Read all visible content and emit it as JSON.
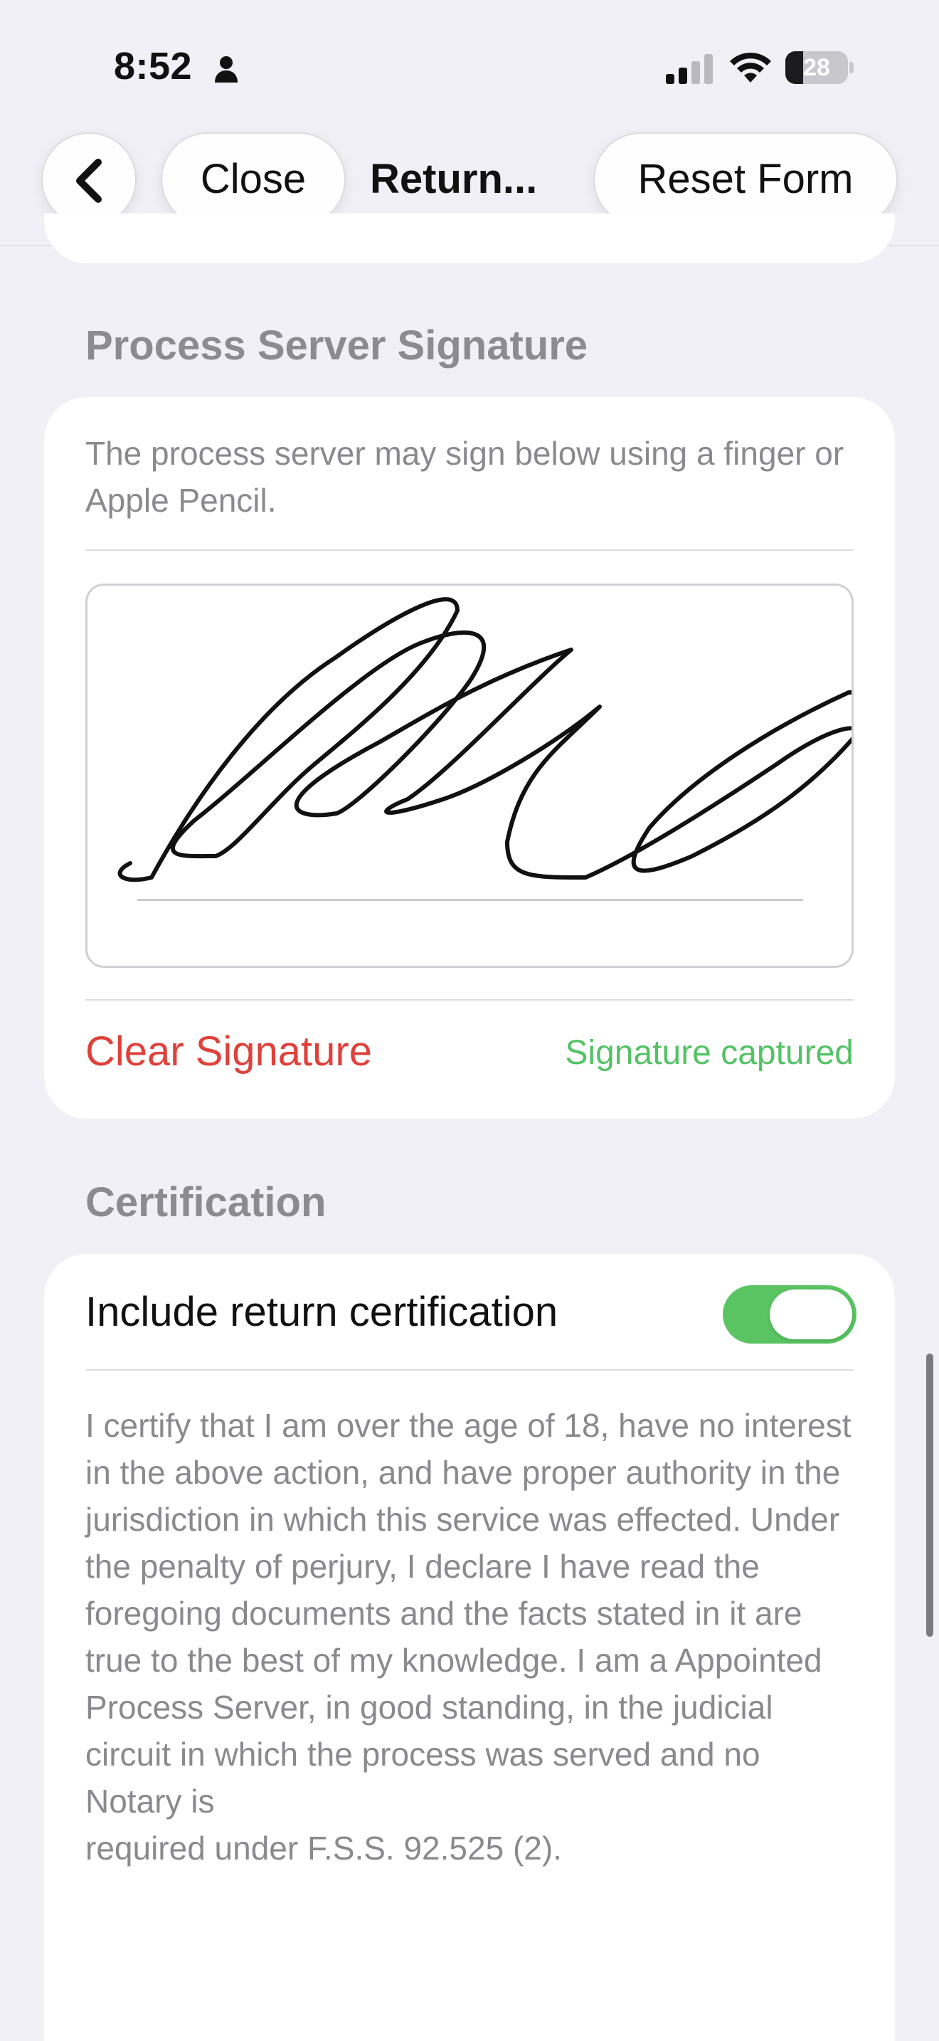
{
  "status_bar": {
    "time": "8:52",
    "battery_level": "28",
    "battery_fraction": 0.28,
    "icons": [
      "person-icon",
      "signal-icon",
      "wifi-icon",
      "battery-icon"
    ]
  },
  "nav": {
    "back_icon": "chevron-left-icon",
    "close_label": "Close",
    "title": "Return...",
    "reset_label": "Reset Form"
  },
  "signature_section": {
    "header": "Process Server Signature",
    "instructions": "The process server may sign below using a finger or Apple Pencil.",
    "clear_label": "Clear Signature",
    "status": "Signature captured"
  },
  "certification_section": {
    "header": "Certification",
    "toggle_label": "Include return certification",
    "toggle_on": true,
    "text_lines": [
      "I certify that I am over the age of 18, have no interest in the above action, and have proper authority in the",
      "jurisdiction in which this service was effected. Under the penalty of perjury, I declare I have read the",
      "foregoing documents and the facts stated in it are true to the best of my knowledge. I am a Appointed",
      "Process Server, in good standing, in the judicial circuit in which the process was served and no Notary is",
      "required under F.S.S. 92.525 (2)."
    ]
  },
  "colors": {
    "background": "#f1f0f6",
    "destructive": "#e0403a",
    "success": "#54c265",
    "toggle_on": "#5ac463",
    "secondary_text": "#8a8a8e"
  }
}
